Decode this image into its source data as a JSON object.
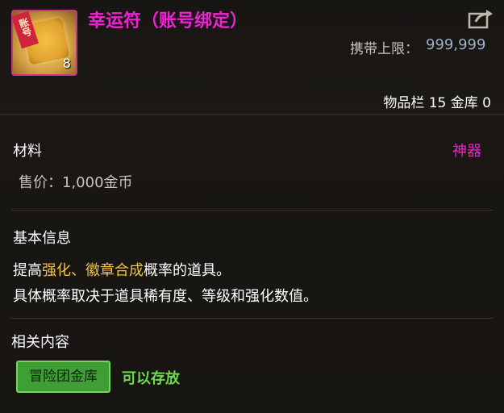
{
  "item": {
    "name": "幸运符（账号绑定）",
    "icon": "lucky-charm-scroll-icon",
    "icon_badge": "账号",
    "stack_count": "8",
    "carry_limit_label": "携带上限：",
    "carry_limit_value": "999,999",
    "storage_text": "物品栏 15 金库 0"
  },
  "details": {
    "category": "材料",
    "rarity": "神器",
    "price": "售价：1,000金币"
  },
  "basic_info": {
    "heading": "基本信息",
    "line1_prefix": "提高",
    "line1_hl1": "强化",
    "line1_sep": "、",
    "line1_hl2": "徽章合成",
    "line1_suffix": "概率的道具。",
    "line2": "具体概率取决于道具稀有度、等级和强化数值。"
  },
  "related": {
    "heading": "相关内容",
    "tag_label": "冒险团金库",
    "tag_status": "可以存放"
  },
  "colors": {
    "name": "#ee22d2",
    "rarity": "#ee22d2",
    "highlight": "#f3c43a",
    "tag_bg": "#3f9f34",
    "tag_status": "#6fd94d"
  }
}
